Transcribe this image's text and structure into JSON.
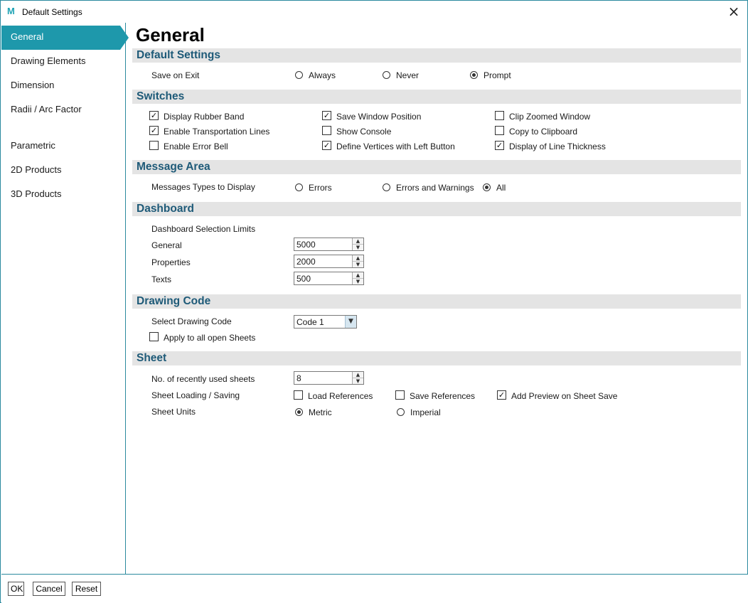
{
  "window": {
    "title": "Default Settings",
    "logo_main": "M",
    "logo_accent": ""
  },
  "sidebar": {
    "items": [
      {
        "label": "General",
        "active": true
      },
      {
        "label": "Drawing Elements"
      },
      {
        "label": "Dimension"
      },
      {
        "label": "Radii / Arc Factor"
      },
      {
        "label": "Parametric"
      },
      {
        "label": "2D Products"
      },
      {
        "label": "3D Products"
      }
    ]
  },
  "page": {
    "title": "General"
  },
  "default_settings": {
    "heading": "Default Settings",
    "save_on_exit_label": "Save on Exit",
    "options": [
      "Always",
      "Never",
      "Prompt"
    ],
    "selected": "Prompt"
  },
  "switches": {
    "heading": "Switches",
    "items": [
      {
        "label": "Display Rubber Band",
        "checked": true
      },
      {
        "label": "Save Window Position",
        "checked": true
      },
      {
        "label": "Clip Zoomed Window",
        "checked": false
      },
      {
        "label": "Enable Transportation Lines",
        "checked": true
      },
      {
        "label": "Show Console",
        "checked": false
      },
      {
        "label": "Copy to Clipboard",
        "checked": false
      },
      {
        "label": "Enable Error Bell",
        "checked": false
      },
      {
        "label": "Define Vertices with Left Button",
        "checked": true
      },
      {
        "label": "Display of Line Thickness",
        "checked": true
      }
    ]
  },
  "message_area": {
    "heading": "Message Area",
    "label": "Messages Types to Display",
    "options": [
      "Errors",
      "Errors and Warnings",
      "All"
    ],
    "selected": "All"
  },
  "dashboard": {
    "heading": "Dashboard",
    "limits_label": "Dashboard Selection Limits",
    "fields": [
      {
        "label": "General",
        "value": "5000"
      },
      {
        "label": "Properties",
        "value": "2000"
      },
      {
        "label": "Texts",
        "value": "500"
      }
    ]
  },
  "drawing_code": {
    "heading": "Drawing Code",
    "select_label": "Select Drawing Code",
    "selected": "Code 1",
    "apply_label": "Apply to all open Sheets",
    "apply_checked": false
  },
  "sheet": {
    "heading": "Sheet",
    "recent_label": "No. of recently used sheets",
    "recent_value": "8",
    "loading_label": "Sheet Loading / Saving",
    "loading_options": [
      {
        "label": "Load References",
        "checked": false
      },
      {
        "label": "Save References",
        "checked": false
      },
      {
        "label": "Add Preview on Sheet Save",
        "checked": true
      }
    ],
    "units_label": "Sheet Units",
    "units_options": [
      "Metric",
      "Imperial"
    ],
    "units_selected": "Metric"
  },
  "footer": {
    "ok": "OK",
    "cancel": "Cancel",
    "reset": "Reset"
  },
  "icons": {
    "check_mark": "✓",
    "close": "×",
    "spin_up": "▲",
    "spin_down": "▼",
    "dropdown_arrow": "▼"
  }
}
